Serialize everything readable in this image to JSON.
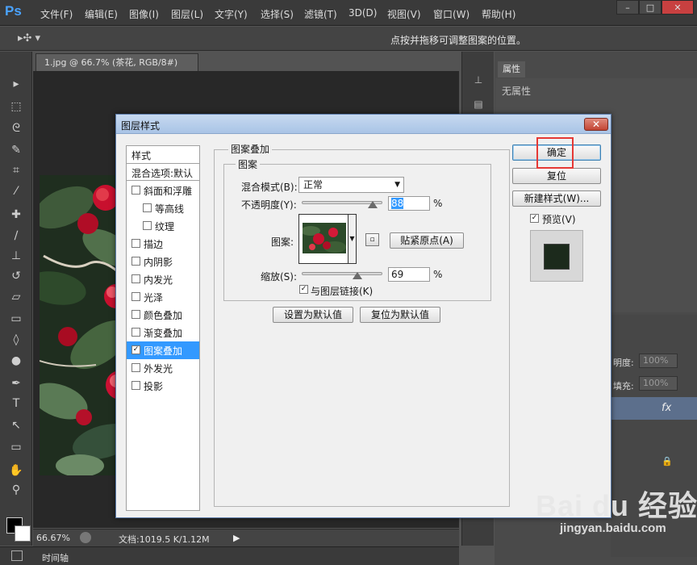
{
  "app": {
    "logo": "Ps",
    "menu": [
      "文件(F)",
      "编辑(E)",
      "图像(I)",
      "图层(L)",
      "文字(Y)",
      "选择(S)",
      "滤镜(T)",
      "3D(D)",
      "视图(V)",
      "窗口(W)",
      "帮助(H)"
    ],
    "window_controls": [
      "–",
      "□",
      "✕"
    ]
  },
  "options_bar": {
    "tool_glyph": "▸✣ ▾",
    "hint": "点按并拖移可调整图案的位置。"
  },
  "document": {
    "tab_title": "1.jpg @ 66.7% (茶花, RGB/8#) *",
    "tab_close": "×"
  },
  "status": {
    "zoom": "66.67%",
    "doc_size": "文档:1019.5 K/1.12M",
    "arrow": "▶",
    "timeline": "时间轴"
  },
  "right_panel": {
    "properties_tab": "属性",
    "no_properties": "无属性",
    "opacity_label": "明度:",
    "opacity_value": "100%",
    "fill_label": "填充:",
    "fill_value": "100%",
    "fx": "fx",
    "lock": "🔒"
  },
  "dialog": {
    "title": "图层样式",
    "close": "✕",
    "styles_header": "样式",
    "blend_defaults": "混合选项:默认",
    "style_items": [
      {
        "label": "斜面和浮雕",
        "checked": false,
        "indent": false
      },
      {
        "label": "等高线",
        "checked": false,
        "indent": true
      },
      {
        "label": "纹理",
        "checked": false,
        "indent": true
      },
      {
        "label": "描边",
        "checked": false,
        "indent": false
      },
      {
        "label": "内阴影",
        "checked": false,
        "indent": false
      },
      {
        "label": "内发光",
        "checked": false,
        "indent": false
      },
      {
        "label": "光泽",
        "checked": false,
        "indent": false
      },
      {
        "label": "颜色叠加",
        "checked": false,
        "indent": false
      },
      {
        "label": "渐变叠加",
        "checked": false,
        "indent": false
      },
      {
        "label": "图案叠加",
        "checked": true,
        "indent": false,
        "selected": true
      },
      {
        "label": "外发光",
        "checked": false,
        "indent": false
      },
      {
        "label": "投影",
        "checked": false,
        "indent": false
      }
    ],
    "pattern_overlay": {
      "group_title": "图案叠加",
      "sub_group_title": "图案",
      "blend_mode_label": "混合模式(B):",
      "blend_mode_value": "正常",
      "opacity_label": "不透明度(Y):",
      "opacity_value": "88",
      "opacity_fraction": 0.88,
      "percent": "%",
      "pattern_label": "图案:",
      "snap_origin": "贴紧原点(A)",
      "scale_label": "缩放(S):",
      "scale_value": "69",
      "scale_fraction": 0.69,
      "link_label": "与图层链接(K)",
      "link_checked": true,
      "make_default": "设置为默认值",
      "reset_default": "复位为默认值"
    },
    "buttons": {
      "ok": "确定",
      "reset": "复位",
      "new_style": "新建样式(W)...",
      "preview_label": "预览(V)",
      "preview_checked": true
    }
  },
  "watermark": {
    "brand": "Bai du 经验",
    "url": "jingyan.baidu.com"
  },
  "colors": {
    "selection": "#3399ff",
    "highlight": "#e53935",
    "ps_blue": "#4aa3ff"
  }
}
